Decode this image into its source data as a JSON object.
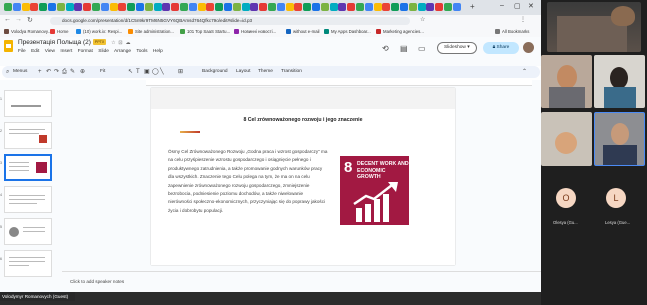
{
  "browser": {
    "url": "docs.google.com/presentation/d/1C5n9kr9TM6N5GVY6QBAmsd764Qfkc79o/edit#slide=id.p3",
    "bookmarks": [
      "Volodya Romanovy...",
      "Home",
      "(10) work.ix: Respi...",
      "Site administration...",
      "101 Top SaaS Startu...",
      "Новинні новості...",
      "without e-mail",
      "My Apps Dashboar...",
      "Marketing agencies...",
      "All Bookmarks"
    ]
  },
  "doc": {
    "title": "Презентація Польща (2)",
    "badge": "PPTX",
    "menu": [
      "File",
      "Edit",
      "View",
      "Insert",
      "Format",
      "Slide",
      "Arrange",
      "Tools",
      "Help"
    ],
    "slideshow_label": "Slideshow",
    "share_label": "Share"
  },
  "toolbar": {
    "menus_label": "Menus",
    "zoom_label": "Fit",
    "background_label": "Background",
    "layout_label": "Layout",
    "theme_label": "Theme",
    "transition_label": "Transition"
  },
  "filmstrip": {
    "numbers": [
      "1",
      "2",
      "3",
      "4",
      "5",
      "6"
    ]
  },
  "slide": {
    "title": "8 Cel zrównoważonego rozwoju i jego znaczenie",
    "body": "Ósmy Cel Zrównoważonego Rozwoju „Godna praca i wzrost gospodarczy\" ma na celu przyśpieszenie wzrostu gospodarczego i osiągnięcie pełnego i produktywnego zatrudnienia, a także promowanie godnych warunków pracy dla wszystkich. Znaczenie tego Celu polega na tym, że ma on na celu zapewnienie zrównoważonego rozwoju gospodarczego, zmniejszenie bezrobocia, podniesienie poziomu dochodów, a także niwelowanie nierówności społeczno-ekonomicznych, przyczyniając się do poprawy jakości życia i dobrobytu populacji.",
    "sdg_number": "8",
    "sdg_text": "DECENT WORK AND ECONOMIC GROWTH",
    "sdg_color": "#a21942"
  },
  "speaker_notes": "Click to add speaker notes",
  "presenter_name": "Volodymyr Romanovych (Guest)",
  "participants": [
    {
      "initial": "O",
      "name": "Olesya (Gu...",
      "color": "#f6d7c3"
    },
    {
      "initial": "L",
      "name": "Lesya (Gue...",
      "color": "#f6d7c3"
    }
  ]
}
